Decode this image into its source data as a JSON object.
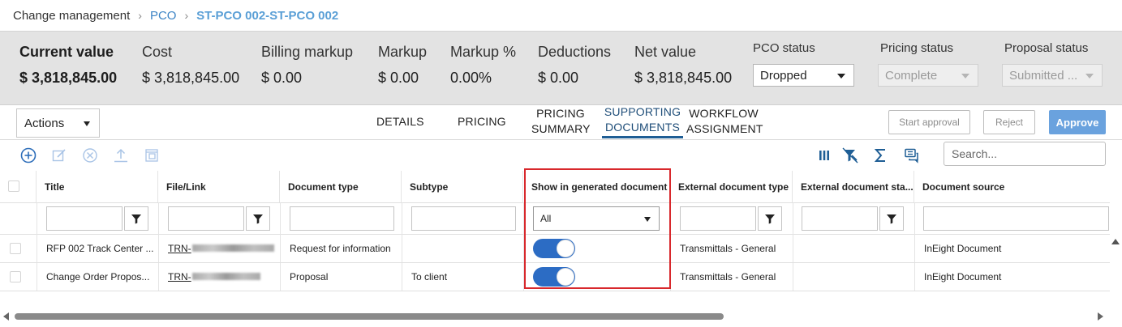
{
  "breadcrumb": {
    "root": "Change management",
    "parent": "PCO",
    "current": "ST-PCO 002-ST-PCO 002",
    "separator": "›"
  },
  "summary": {
    "current_value_label": "Current value",
    "current_value": "$ 3,818,845.00",
    "cost_label": "Cost",
    "cost": "$ 3,818,845.00",
    "billing_markup_label": "Billing markup",
    "billing_markup": "$ 0.00",
    "markup_label": "Markup",
    "markup": "$ 0.00",
    "markup_pct_label": "Markup %",
    "markup_pct": "0.00%",
    "deductions_label": "Deductions",
    "deductions": "$ 0.00",
    "net_value_label": "Net value",
    "net_value": "$ 3,818,845.00",
    "pco_status_label": "PCO status",
    "pco_status": "Dropped",
    "pricing_status_label": "Pricing status",
    "pricing_status": "Complete",
    "proposal_status_label": "Proposal status",
    "proposal_status": "Submitted ..."
  },
  "tabs": {
    "actions_label": "Actions",
    "details": "DETAILS",
    "pricing": "PRICING",
    "pricing_summary_1": "PRICING",
    "pricing_summary_2": "SUMMARY",
    "supporting_docs_1": "SUPPORTING",
    "supporting_docs_2": "DOCUMENTS",
    "workflow_1": "WORKFLOW",
    "workflow_2": "ASSIGNMENT",
    "start_approval": "Start approval",
    "reject": "Reject",
    "approve": "Approve"
  },
  "toolbar": {
    "search_placeholder": "Search..."
  },
  "grid": {
    "columns": {
      "title": "Title",
      "file_link": "File/Link",
      "document_type": "Document type",
      "subtype": "Subtype",
      "show_in_generated": "Show in generated document",
      "external_doc_type": "External document type",
      "external_doc_status": "External document sta...",
      "document_source": "Document source"
    },
    "filter_show_value": "All",
    "rows": [
      {
        "title": "RFP 002 Track Center ...",
        "file_link": "TRN-",
        "document_type": "Request for information",
        "subtype": "",
        "show_in_generated": true,
        "external_doc_type": "Transmittals - General",
        "external_doc_status": "",
        "document_source": "InEight Document"
      },
      {
        "title": "Change Order Propos...",
        "file_link": "TRN-",
        "document_type": "Proposal",
        "subtype": "To client",
        "show_in_generated": true,
        "external_doc_type": "Transmittals - General",
        "external_doc_status": "",
        "document_source": "InEight Document"
      }
    ]
  },
  "colors": {
    "accent_blue": "#2c6cc4",
    "approve_button": "#6aa2de",
    "highlight_border": "#d8282c",
    "summary_bg": "#e3e3e3"
  }
}
